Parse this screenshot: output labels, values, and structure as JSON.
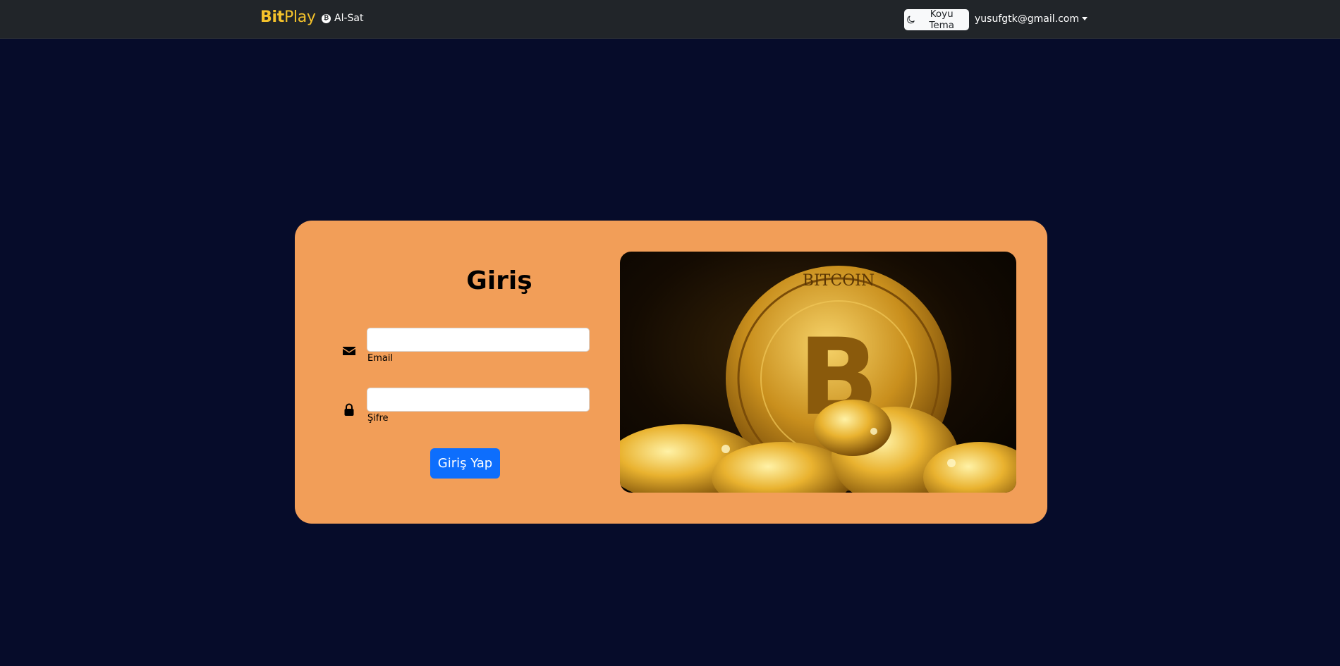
{
  "navbar": {
    "brand_bold": "Bit",
    "brand_light": "Play",
    "nav_link": "Al-Sat",
    "theme_button": "Koyu Tema",
    "user_email": "yusufgtk@gmail.com"
  },
  "login": {
    "title": "Giriş",
    "email_label": "Email",
    "email_value": "",
    "password_label": "Şifre",
    "password_value": "",
    "submit_label": "Giriş Yap"
  },
  "photo": {
    "coin_text": "BITCOIN",
    "coin_symbol": "B"
  },
  "colors": {
    "page_bg": "#060c2a",
    "navbar_bg": "#212529",
    "brand": "#f4c22b",
    "card_bg": "#f29e58",
    "primary": "#0d6efd"
  }
}
